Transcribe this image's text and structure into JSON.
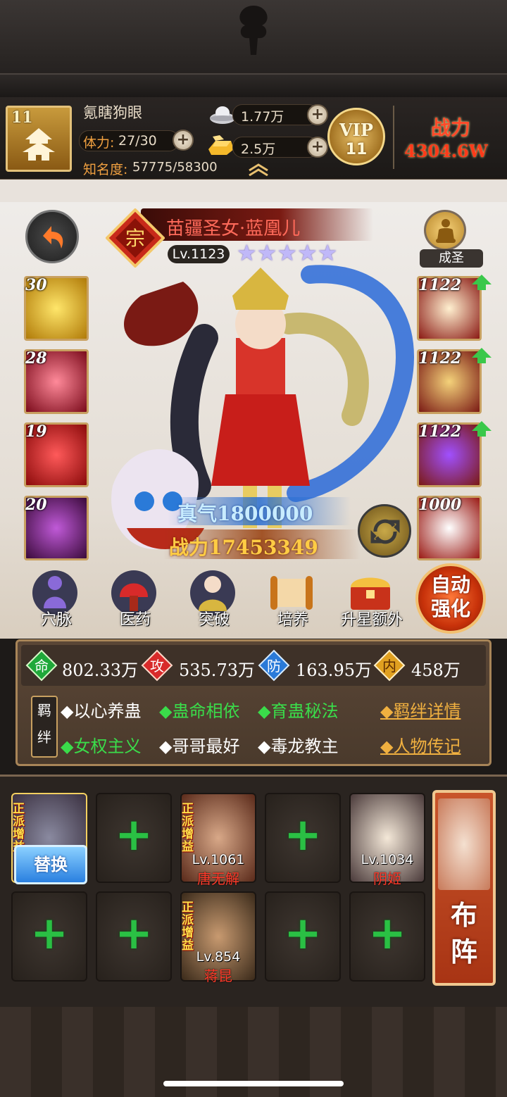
{
  "player": {
    "name": "氪瞎狗眼",
    "avatar_level": "11",
    "stamina_label": "体力:",
    "stamina_value": "27/30",
    "fame_label": "知名度:",
    "fame_value": "57775/58300",
    "silver": "1.77万",
    "gold": "2.5万",
    "vip_label": "VIP",
    "vip_level": "11",
    "power_label": "战力",
    "power_value": "4304.6W"
  },
  "hero": {
    "name": "苗疆圣女·蓝凰儿",
    "level": "Lv.1123",
    "stars": "★★★★★",
    "saint_label": "成圣",
    "qi_label": "真气",
    "qi_value": "1800000",
    "combat_label": "战力",
    "combat_value": "17453349"
  },
  "skills_left": [
    {
      "num": "30",
      "icon": "gold-swirl-skill-icon"
    },
    {
      "num": "28",
      "icon": "skull-skill-icon"
    },
    {
      "num": "19",
      "icon": "blade-skill-icon"
    },
    {
      "num": "20",
      "icon": "purple-orb-skill-icon"
    }
  ],
  "equip_right": [
    {
      "num": "1122",
      "icon": "conch-equip-icon"
    },
    {
      "num": "1122",
      "icon": "armor-equip-icon"
    },
    {
      "num": "1122",
      "icon": "orb-equip-icon"
    },
    {
      "num": "1000",
      "icon": "white-beast-equip-icon"
    }
  ],
  "nav": [
    {
      "label": "穴脉"
    },
    {
      "label": "医药"
    },
    {
      "label": "突破"
    },
    {
      "label": "培养"
    },
    {
      "label": "升星额外"
    }
  ],
  "auto_enhance": {
    "line1": "自动",
    "line2": "强化"
  },
  "stats": [
    {
      "key": "命",
      "value": "802.33万",
      "color": "#1fa83a"
    },
    {
      "key": "攻",
      "value": "535.73万",
      "color": "#d82a2a"
    },
    {
      "key": "防",
      "value": "163.95万",
      "color": "#2a7ad8"
    },
    {
      "key": "内",
      "value": "458万",
      "color": "#e0a020"
    }
  ],
  "bond": {
    "tag": "羁绊",
    "row1": [
      {
        "text": "◆以心养蛊",
        "active": false
      },
      {
        "text": "◆蛊命相依",
        "active": true
      },
      {
        "text": "◆育蛊秘法",
        "active": true
      }
    ],
    "row2": [
      {
        "text": "◆女权主义",
        "active": true
      },
      {
        "text": "◆哥哥最好",
        "active": false
      },
      {
        "text": "◆毒龙教主",
        "active": false
      }
    ],
    "detail_link": "◆羁绊详情",
    "bio_link": "◆人物传记"
  },
  "lineup": {
    "badge": "正派增益",
    "replace_label": "替换",
    "plus": "+",
    "heroes": [
      {
        "level": "Lv.1061",
        "name": "唐无解"
      },
      {
        "level": "Lv.1034",
        "name": "阴姬"
      },
      {
        "level": "Lv.854",
        "name": "蒋昆"
      }
    ],
    "formation_label1": "布",
    "formation_label2": "阵"
  },
  "colors": {
    "active_bond": "#3adc4a",
    "inactive_bond": "#ffffff",
    "link": "#f0b040",
    "plus_green": "#2ac044"
  }
}
